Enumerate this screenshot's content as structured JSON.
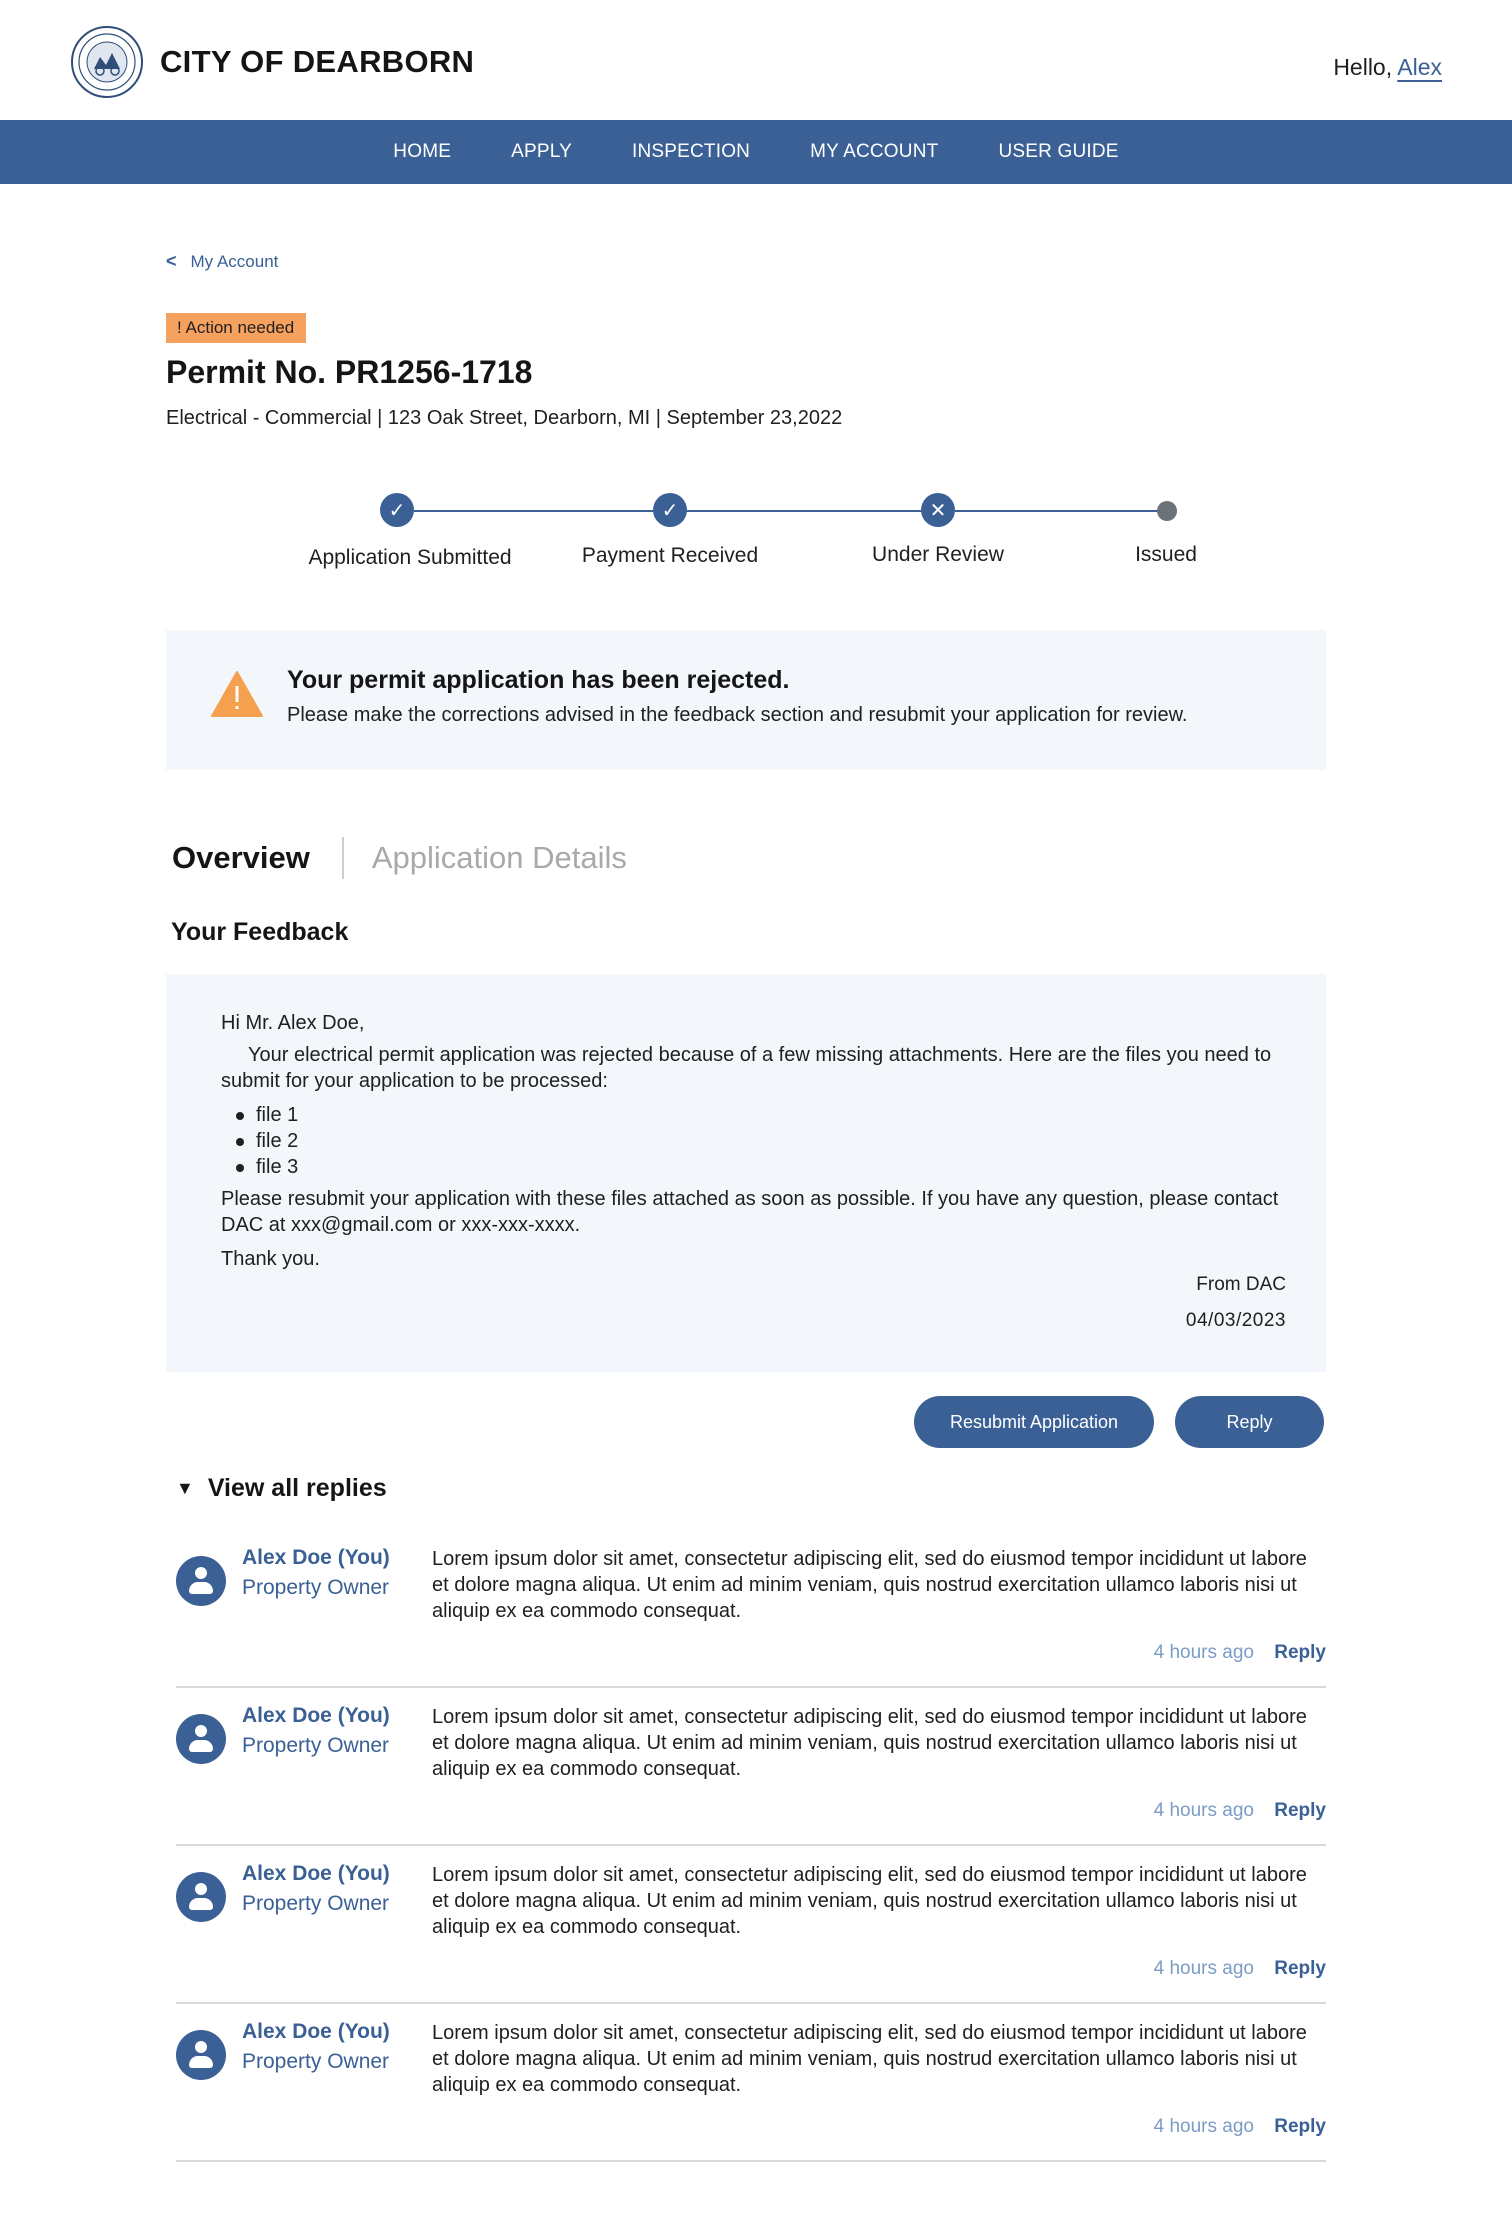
{
  "header": {
    "site_title": "CITY OF DEARBORN",
    "greeting_prefix": "Hello, ",
    "user_name": "Alex"
  },
  "nav": {
    "items": [
      "HOME",
      "APPLY",
      "INSPECTION",
      "MY ACCOUNT",
      "USER GUIDE"
    ]
  },
  "breadcrumb": {
    "back_label": "My Account"
  },
  "permit": {
    "badge": "! Action needed",
    "title": "Permit No. PR1256-1718",
    "subtitle": "Electrical - Commercial | 123 Oak Street, Dearborn, MI | September 23,2022"
  },
  "stepper": {
    "steps": [
      {
        "label": "Application Submitted",
        "status": "done"
      },
      {
        "label": "Payment Received",
        "status": "done"
      },
      {
        "label": "Under Review",
        "status": "rejected"
      },
      {
        "label": "Issued",
        "status": "pending"
      }
    ]
  },
  "alert": {
    "title": "Your permit application has been rejected.",
    "text": "Please make the corrections advised in the feedback section and resubmit your application for review."
  },
  "tabs": {
    "overview": "Overview",
    "details": "Application Details"
  },
  "feedback": {
    "heading": "Your Feedback",
    "greeting": "Hi Mr. Alex Doe,",
    "body": "Your electrical permit application was rejected because of a few missing attachments. Here are the files you need to submit for your application to be processed:",
    "files": [
      "file 1",
      "file 2",
      "file 3"
    ],
    "closing": "Please resubmit your application with these files attached as soon as possible. If you have any question, please contact DAC at xxx@gmail.com or xxx-xxx-xxxx.",
    "thanks": "Thank you.",
    "from": "From DAC",
    "date": "04/03/2023"
  },
  "actions": {
    "resubmit": "Resubmit Application",
    "reply": "Reply"
  },
  "replies": {
    "toggle_label": "View all replies",
    "items": [
      {
        "name": "Alex Doe (You)",
        "role": "Property Owner",
        "text": "Lorem ipsum dolor sit amet, consectetur adipiscing elit, sed do eiusmod tempor incididunt ut labore et dolore magna aliqua. Ut enim ad minim veniam, quis nostrud exercitation ullamco laboris nisi ut aliquip ex ea commodo consequat.",
        "time": "4 hours ago",
        "reply_label": "Reply"
      },
      {
        "name": "Alex Doe (You)",
        "role": "Property Owner",
        "text": "Lorem ipsum dolor sit amet, consectetur adipiscing elit, sed do eiusmod tempor incididunt ut labore et dolore magna aliqua. Ut enim ad minim veniam, quis nostrud exercitation ullamco laboris nisi ut aliquip ex ea commodo consequat.",
        "time": "4 hours ago",
        "reply_label": "Reply"
      },
      {
        "name": "Alex Doe (You)",
        "role": "Property Owner",
        "text": "Lorem ipsum dolor sit amet, consectetur adipiscing elit, sed do eiusmod tempor incididunt ut labore et dolore magna aliqua. Ut enim ad minim veniam, quis nostrud exercitation ullamco laboris nisi ut aliquip ex ea commodo consequat.",
        "time": "4 hours ago",
        "reply_label": "Reply"
      },
      {
        "name": "Alex Doe (You)",
        "role": "Property Owner",
        "text": "Lorem ipsum dolor sit amet, consectetur adipiscing elit, sed do eiusmod tempor incididunt ut labore et dolore magna aliqua. Ut enim ad minim veniam, quis nostrud exercitation ullamco laboris nisi ut aliquip ex ea commodo consequat.",
        "time": "4 hours ago",
        "reply_label": "Reply"
      }
    ]
  },
  "colors": {
    "brand": "#3a6096",
    "badge": "#f7a15f",
    "warning": "#f5a04f",
    "panel": "#f3f6fa"
  }
}
